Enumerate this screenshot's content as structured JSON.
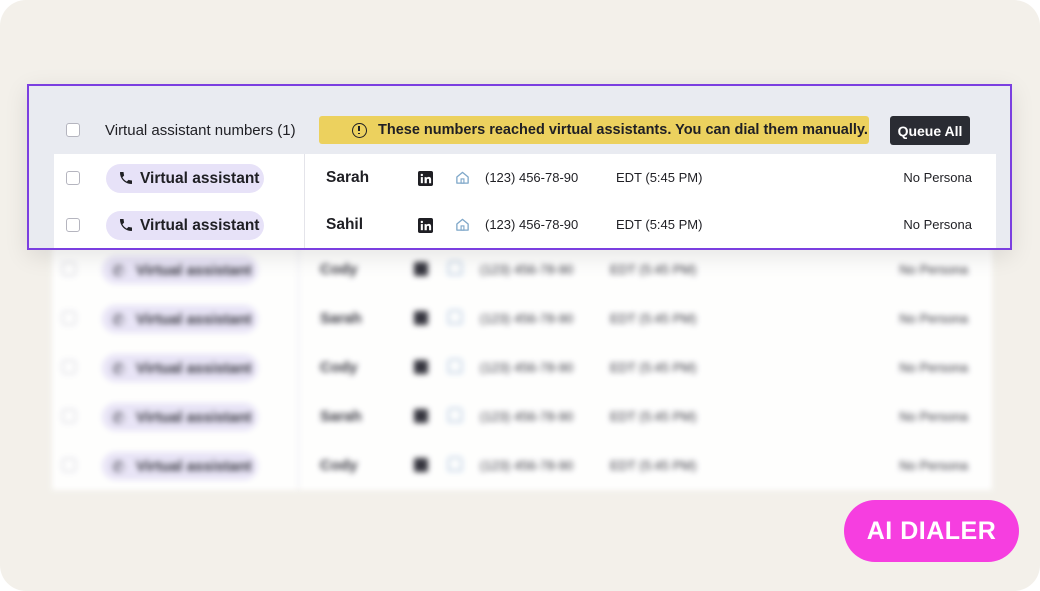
{
  "panel": {
    "header": {
      "title": "Virtual assistant numbers (1)",
      "banner_text": "These numbers reached virtual assistants. You can dial them manually.",
      "queue_all_label": "Queue All"
    },
    "rows": [
      {
        "tag": "Virtual assistant",
        "name": "Sarah",
        "phone": "(123) 456-78-90",
        "timezone": "EDT (5:45 PM)",
        "persona": "No Persona"
      },
      {
        "tag": "Virtual assistant",
        "name": "Sahil",
        "phone": "(123) 456-78-90",
        "timezone": "EDT (5:45 PM)",
        "persona": "No Persona"
      }
    ]
  },
  "background_rows": [
    {
      "tag": "Virtual assistant",
      "name": "Cody",
      "phone": "(123) 456-78-90",
      "timezone": "EDT (5:45 PM)",
      "persona": "No Persona"
    },
    {
      "tag": "Virtual assistant",
      "name": "Sarah",
      "phone": "(123) 456-78-90",
      "timezone": "EDT (5:45 PM)",
      "persona": "No Persona"
    },
    {
      "tag": "Virtual assistant",
      "name": "Cody",
      "phone": "(123) 456-78-90",
      "timezone": "EDT (5:45 PM)",
      "persona": "No Persona"
    },
    {
      "tag": "Virtual assistant",
      "name": "Sarah",
      "phone": "(123) 456-78-90",
      "timezone": "EDT (5:45 PM)",
      "persona": "No Persona"
    },
    {
      "tag": "Virtual assistant",
      "name": "Cody",
      "phone": "(123) 456-78-90",
      "timezone": "EDT (5:45 PM)",
      "persona": "No Persona"
    }
  ],
  "badge": {
    "label": "AI DIALER"
  },
  "icons": {
    "tag_icon": "phone-icon",
    "profile_icon": "linkedin-icon",
    "address_icon": "home-icon",
    "banner_icon": "warning-icon"
  },
  "colors": {
    "focus_border": "#7b3fe0",
    "banner_bg": "#ecd15e",
    "pill_bg": "#e7e2f8",
    "badge_bg": "#f63ee0",
    "button_bg": "#2a2c33"
  }
}
